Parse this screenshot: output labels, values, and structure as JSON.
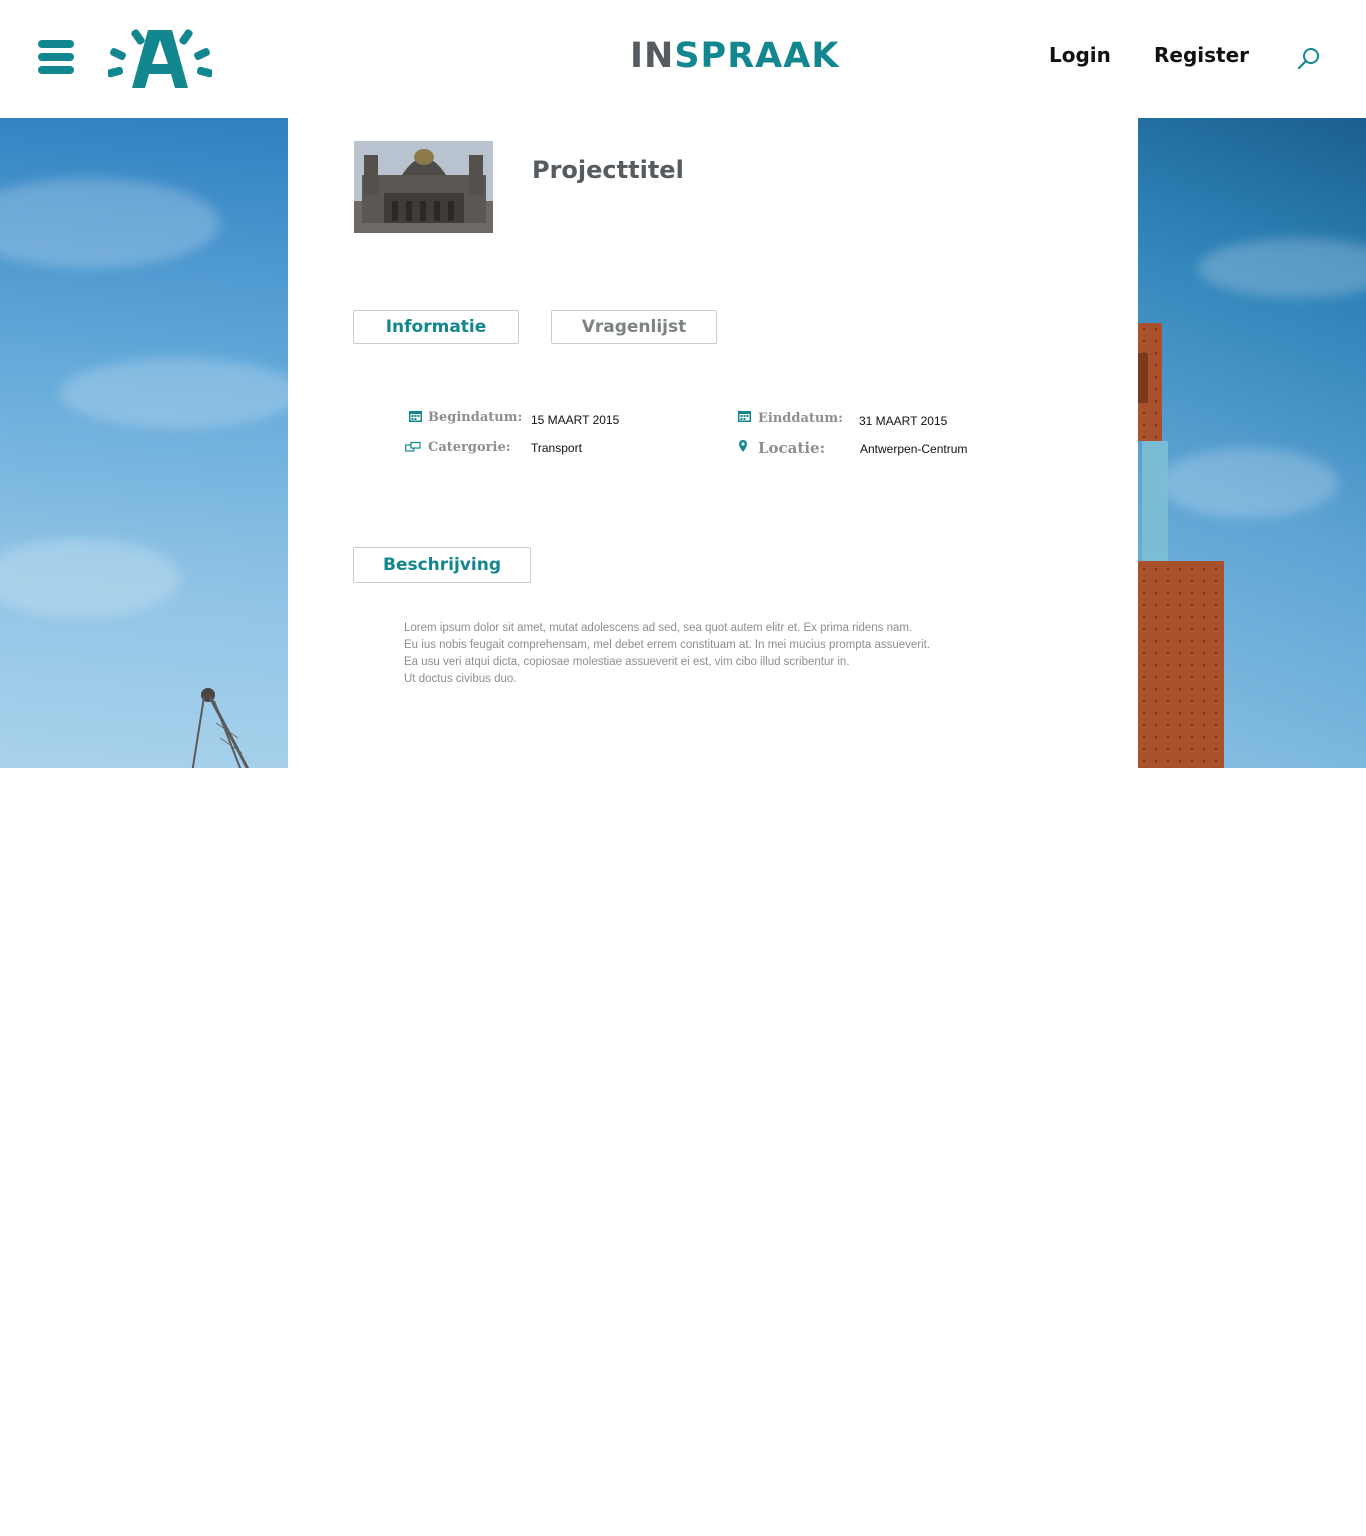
{
  "header": {
    "brand_in": "IN",
    "brand_spraak": "SPRAAK",
    "login_label": "Login",
    "register_label": "Register",
    "logo_letter": "A"
  },
  "colors": {
    "accent": "#13878f",
    "text_dark": "#555b5e",
    "text_muted": "#8b8f92"
  },
  "icons": {
    "menu": "hamburger-icon",
    "search": "search-icon",
    "begin_date": "calendar-icon",
    "end_date": "calendar-icon",
    "category": "category-icon",
    "location": "map-pin-icon"
  },
  "project": {
    "title": "Projecttitel"
  },
  "tabs": [
    {
      "label": "Informatie",
      "active": true
    },
    {
      "label": "Vragenlijst",
      "active": false
    }
  ],
  "info": {
    "begin_label": "Begindatum:",
    "begin_value": "15 MAART 2015",
    "end_label": "Einddatum:",
    "end_value": "31 MAART 2015",
    "category_label": "Catergorie:",
    "category_value": "Transport",
    "location_label": "Locatie:",
    "location_value": "Antwerpen-Centrum"
  },
  "description": {
    "heading": "Beschrijving",
    "lines": [
      "Lorem ipsum dolor sit amet, mutat adolescens ad sed, sea quot autem elitr et. Ex prima ridens nam.",
      "Eu ius nobis feugait comprehensam, mel debet errem constituam at. In mei mucius prompta assueverit.",
      "Ea usu veri atqui dicta, copiosae molestiae assueverit ei est, vim cibo illud scribentur in.",
      "Ut doctus civibus duo."
    ]
  }
}
